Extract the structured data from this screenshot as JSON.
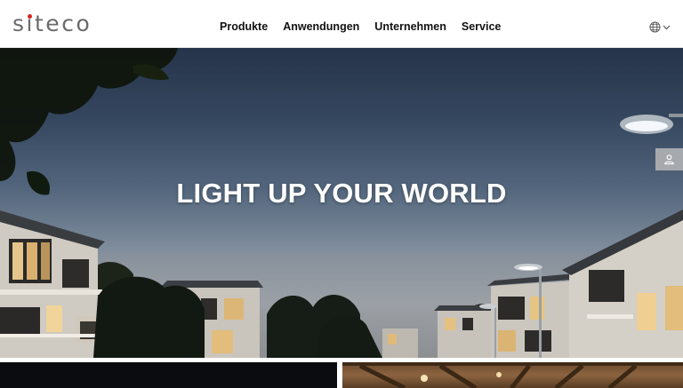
{
  "header": {
    "logo_text": "siteco",
    "nav": [
      {
        "label": "Produkte"
      },
      {
        "label": "Anwendungen"
      },
      {
        "label": "Unternehmen"
      },
      {
        "label": "Service"
      }
    ],
    "language_icon": "globe-icon",
    "language_chevron_icon": "chevron-down-icon"
  },
  "hero": {
    "title": "LIGHT UP YOUR WORLD",
    "user_icon": "user-icon"
  },
  "colors": {
    "logo_accent": "#d7231f",
    "logo_text": "#6a6a6a",
    "nav_text": "#111111",
    "hero_sky_top": "#26344a",
    "hero_title": "#ffffff"
  }
}
